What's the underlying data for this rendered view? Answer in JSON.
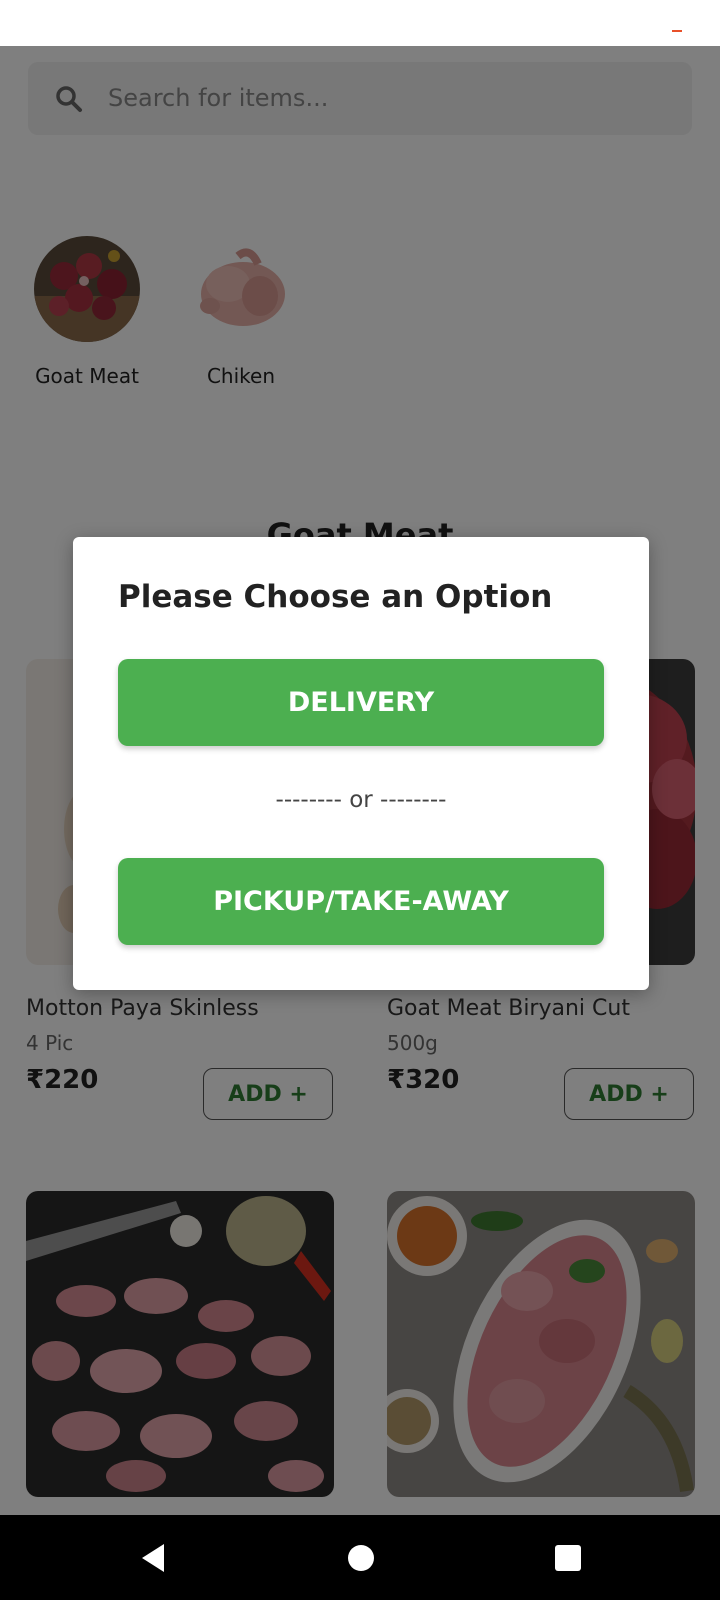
{
  "search": {
    "placeholder": "Search for items..."
  },
  "categories": [
    {
      "label": "Goat Meat",
      "icon": "goat-meat-thumbnail"
    },
    {
      "label": "Chiken",
      "icon": "chicken-thumbnail"
    }
  ],
  "section": {
    "title": "Goat Meat"
  },
  "products": [
    {
      "name": "Motton Paya Skinless",
      "quantity": "4 Pic",
      "price": "₹220",
      "add_label": "ADD +"
    },
    {
      "name": "Goat Meat Biryani Cut",
      "quantity": "500g",
      "price": "₹320",
      "add_label": "ADD +"
    }
  ],
  "dialog": {
    "title": "Please Choose an Option",
    "delivery_label": "DELIVERY",
    "separator": "-------- or --------",
    "pickup_label": "PICKUP/TAKE-AWAY"
  },
  "colors": {
    "accent": "#4caf50",
    "add_text": "#2e7d32",
    "overlay": "rgba(0,0,0,0.5)"
  },
  "nav": {
    "icons": [
      "back-icon",
      "home-icon",
      "recent-apps-icon"
    ]
  }
}
